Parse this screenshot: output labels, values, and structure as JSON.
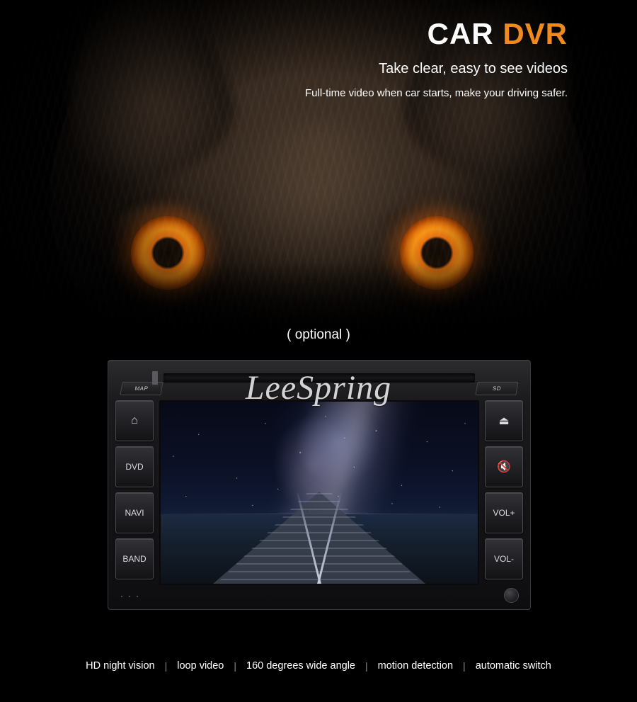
{
  "header": {
    "title_main": "CAR",
    "title_accent": "DVR",
    "subtitle": "Take clear, easy to see videos",
    "description": "Full-time video when car starts, make your driving safer."
  },
  "optional_label": "( optional )",
  "watermark": "LeeSpring",
  "device": {
    "top_left_button": "MAP",
    "top_right_button": "SD",
    "left_buttons": [
      {
        "name": "home",
        "label": "⌂"
      },
      {
        "name": "dvd",
        "label": "DVD"
      },
      {
        "name": "navi",
        "label": "NAVI"
      },
      {
        "name": "band",
        "label": "BAND"
      }
    ],
    "right_buttons": [
      {
        "name": "eject",
        "label": "⏏"
      },
      {
        "name": "mute",
        "label": "🔇"
      },
      {
        "name": "volume-up",
        "label": "VOL+"
      },
      {
        "name": "volume-down",
        "label": "VOL-"
      }
    ]
  },
  "features": [
    "HD night vision",
    "loop video",
    "160 degrees wide angle",
    "motion detection",
    "automatic switch"
  ],
  "separator": "|",
  "colors": {
    "background": "#000000",
    "accent": "#f08a1e",
    "text": "#ffffff",
    "eye_glow": "#ff7b10"
  }
}
